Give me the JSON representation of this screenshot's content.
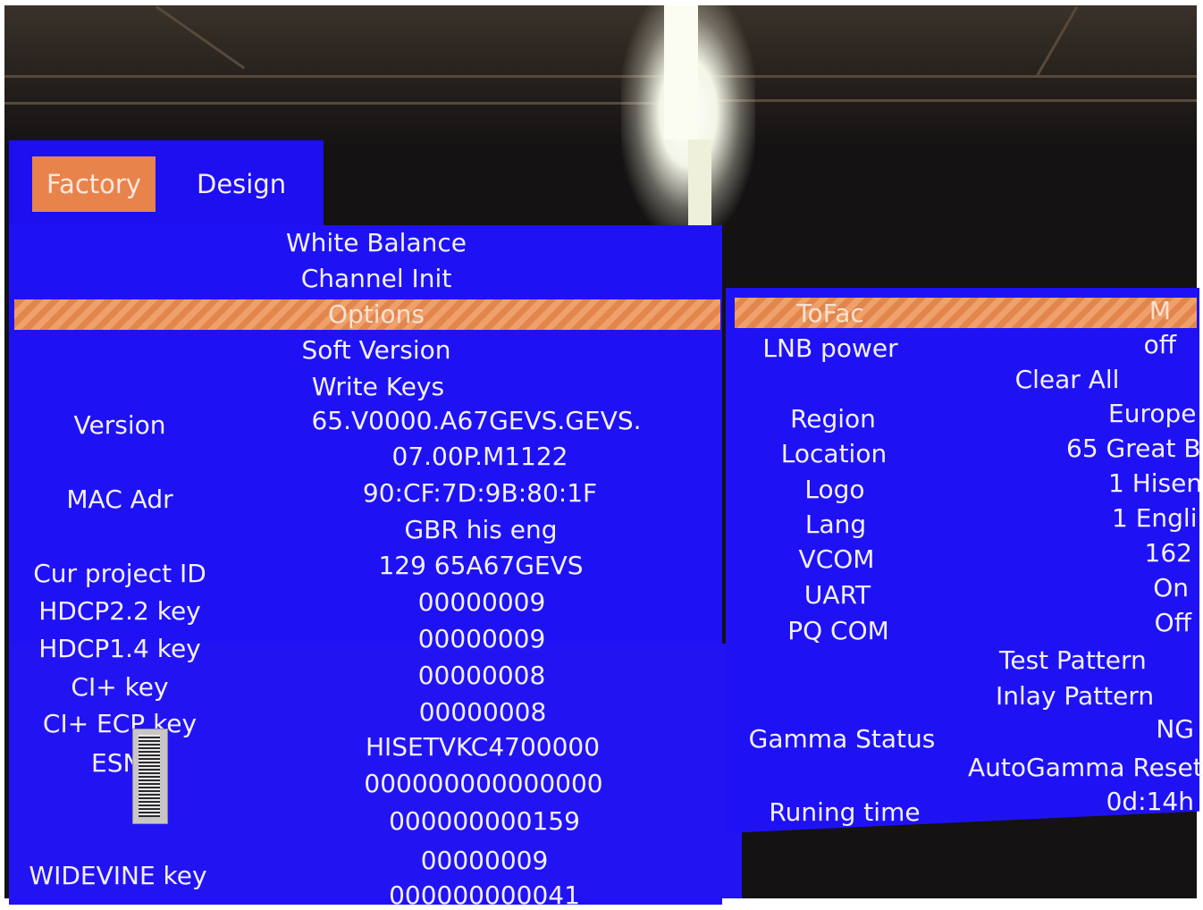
{
  "tabs": [
    {
      "label": "Factory",
      "active": true
    },
    {
      "label": "Design",
      "active": false
    }
  ],
  "menu": {
    "items": [
      "White Balance",
      "Channel Init",
      "Options",
      "Soft Version",
      "Write Keys"
    ],
    "selected": "Options"
  },
  "info_rows": [
    {
      "label": "Version",
      "value": "65.V0000.A67GEVS.GEVS."
    },
    {
      "label": "",
      "value": "07.00P.M1122"
    },
    {
      "label": "MAC Adr",
      "value": "90:CF:7D:9B:80:1F"
    },
    {
      "label": "",
      "value": "GBR his eng"
    },
    {
      "label": "Cur project ID",
      "value": "129 65A67GEVS"
    },
    {
      "label": "HDCP2.2 key",
      "value": "00000009"
    },
    {
      "label": "HDCP1.4 key",
      "value": "00000009"
    },
    {
      "label": "CI+ key",
      "value": "00000008"
    },
    {
      "label": "CI+ ECP key",
      "value": "00000008"
    },
    {
      "label": "ESN",
      "value": "HISETVKC4700000"
    },
    {
      "label": "",
      "value": "000000000000000"
    },
    {
      "label": "",
      "value": "000000000159"
    },
    {
      "label": "WIDEVINE key",
      "value": "00000009"
    },
    {
      "label": "",
      "value": "000000000041"
    }
  ],
  "options_panel": {
    "rows": [
      {
        "label": "ToFac",
        "value": "M"
      },
      {
        "label": "LNB power",
        "value": "off"
      },
      {
        "label": "",
        "value": "Clear All"
      },
      {
        "label": "Region",
        "value": "Europe"
      },
      {
        "label": "Location",
        "value": "65 Great B"
      },
      {
        "label": "Logo",
        "value": "1 Hisen"
      },
      {
        "label": "Lang",
        "value": "1 Engli"
      },
      {
        "label": "VCOM",
        "value": "162"
      },
      {
        "label": "UART",
        "value": "On"
      },
      {
        "label": "PQ COM",
        "value": "Off"
      },
      {
        "label": "",
        "value": "Test  Pattern"
      },
      {
        "label": "",
        "value": "Inlay  Pattern"
      },
      {
        "label": "Gamma Status",
        "value": "NG"
      },
      {
        "label": "",
        "value": "AutoGamma Reset"
      },
      {
        "label": "Runing time",
        "value": "0d:14h"
      }
    ]
  },
  "colors": {
    "panel_blue": "#1e12f4",
    "highlight_orange": "#e8834c",
    "text": "#f3f0ff"
  }
}
